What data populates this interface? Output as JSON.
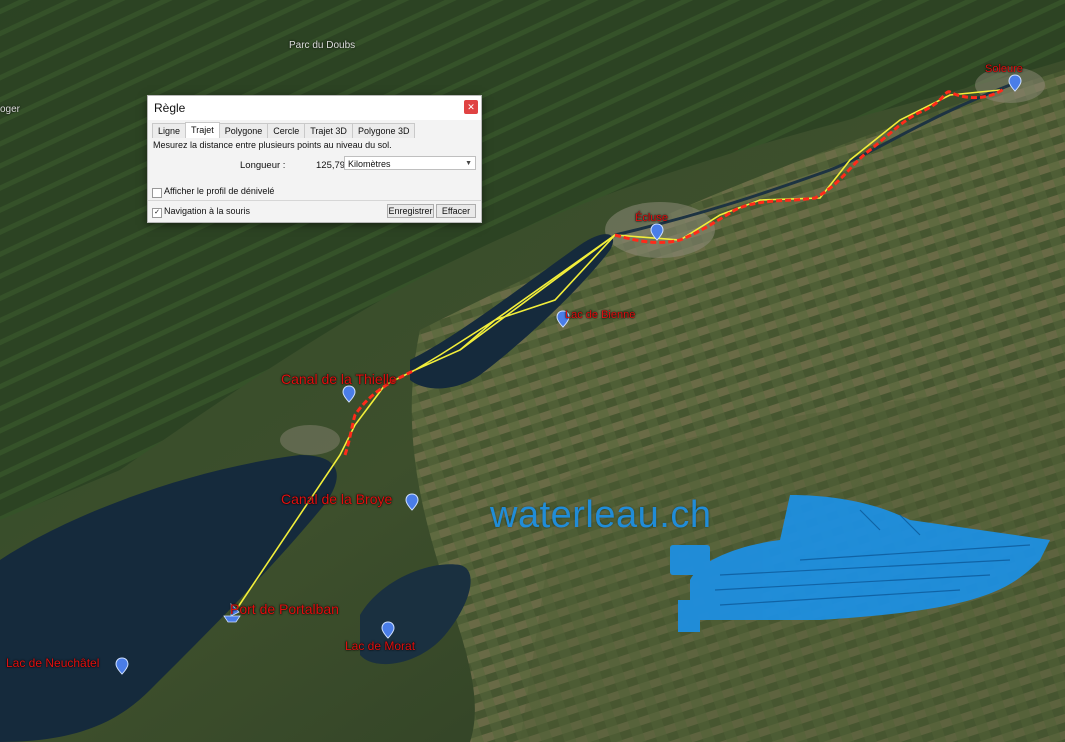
{
  "map": {
    "places": {
      "parc_doubs": "Parc du Doubs",
      "edge_left": "oger",
      "soleure": "Soleure",
      "ecluse": "Écluse",
      "lac_bienne": "Lac de Bienne",
      "canal_thielle": "Canal de la Thielle",
      "canal_broye": "Canal de la Broye",
      "port_portalban": "Port de Portalban",
      "lac_morat": "Lac de Morat",
      "lac_neuchatel": "Lac de Neuchâtel"
    },
    "route_color": "#ff2a1a",
    "ruler_line_color": "#f2ee3a",
    "pin_color": "#4a7de8"
  },
  "brand": {
    "text": "waterleau.ch",
    "color": "#1e8fe0"
  },
  "dialog": {
    "title": "Règle",
    "close_icon": "close-icon",
    "tabs": [
      {
        "label": "Ligne",
        "active": false
      },
      {
        "label": "Trajet",
        "active": true
      },
      {
        "label": "Polygone",
        "active": false
      },
      {
        "label": "Cercle",
        "active": false
      },
      {
        "label": "Trajet 3D",
        "active": false
      },
      {
        "label": "Polygone 3D",
        "active": false
      }
    ],
    "description": "Mesurez la distance entre plusieurs points au niveau du sol.",
    "length_label": "Longueur :",
    "length_value": "125,79",
    "unit": "Kilomètres",
    "elevation_profile_label": "Afficher le profil de dénivelé",
    "elevation_profile_checked": false,
    "mouse_nav_label": "Navigation à la souris",
    "mouse_nav_checked": true,
    "save_label": "Enregistrer",
    "clear_label": "Effacer"
  }
}
